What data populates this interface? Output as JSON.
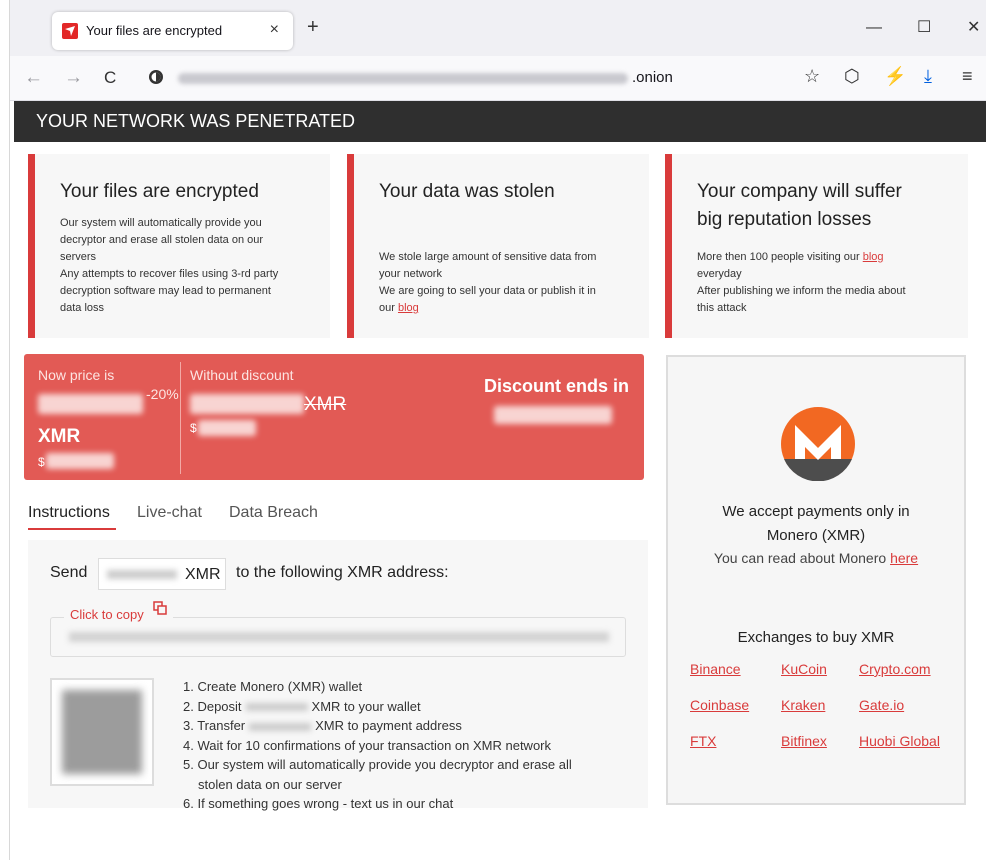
{
  "browser": {
    "tab_title": "Your files are encrypted",
    "tab_close": "×",
    "new_tab": "+",
    "window_controls": {
      "minimize": "—",
      "maximize": "☐",
      "close": "✕"
    },
    "nav": {
      "back": "←",
      "forward": "→",
      "reload": "C"
    },
    "url_suffix": ".onion",
    "icons": {
      "bookmark": "☆",
      "shield": "⬡",
      "extension": "⚡",
      "download": "⤓",
      "menu": "≡"
    }
  },
  "banner": {
    "title": "YOUR NETWORK WAS PENETRATED"
  },
  "cards": [
    {
      "title": "Your files are encrypted",
      "lines": [
        "Our system will automatically provide you",
        "decryptor and erase all stolen data on our",
        "servers",
        "Any attempts to recover files using 3-rd party",
        "decryption software may lead to permanent",
        "data loss"
      ]
    },
    {
      "title": "Your data was stolen",
      "lines": [
        "We stole large amount of sensitive data from",
        "your network",
        "We are going to sell your data or publish it in",
        "our"
      ],
      "link": "blog"
    },
    {
      "title_line1": "Your company will suffer",
      "title_line2": "big reputation losses",
      "line1": "More then 100 people visiting our",
      "link": "blog",
      "lines": [
        "everyday",
        "After publishing we inform the media about",
        "this attack"
      ]
    }
  ],
  "price": {
    "now_label": "Now price is",
    "discount_pct": "-20%",
    "xmr": "XMR",
    "dollar": "$",
    "without_label": "Without discount",
    "without_xmr": "XMR",
    "without_dollar": "$",
    "discount_ends": "Discount ends in"
  },
  "monero": {
    "accept_line1": "We accept payments only in",
    "accept_line2": "Monero (XMR)",
    "read_text": "You can read about Monero",
    "read_link": "here",
    "exchanges_title": "Exchanges to buy XMR",
    "exchanges": [
      "Binance",
      "KuCoin",
      "Crypto.com",
      "Coinbase",
      "Kraken",
      "Gate.io",
      "FTX",
      "Bitfinex",
      "Huobi Global"
    ],
    "brand_color": "#f26822"
  },
  "tabs": {
    "instructions": "Instructions",
    "livechat": "Live-chat",
    "breach": "Data Breach"
  },
  "instructions": {
    "send": "Send",
    "xmr": "XMR",
    "to_address": "to the following XMR address:",
    "click_copy": "Click to copy",
    "steps": {
      "s1": "1. Create Monero (XMR) wallet",
      "s2a": "2. Deposit",
      "s2b": "XMR to your wallet",
      "s3a": "3. Transfer",
      "s3b": "XMR to payment address",
      "s4": "4. Wait for 10 confirmations of your transaction on XMR network",
      "s5a": "5. Our system will automatically provide you decryptor and erase all",
      "s5b": "stolen data on our server",
      "s6": "6. If something goes wrong - text us in our chat"
    }
  },
  "colors": {
    "accent": "#d93b3b",
    "price_bg": "#e25a55",
    "banner_bg": "#2f2f2f"
  }
}
